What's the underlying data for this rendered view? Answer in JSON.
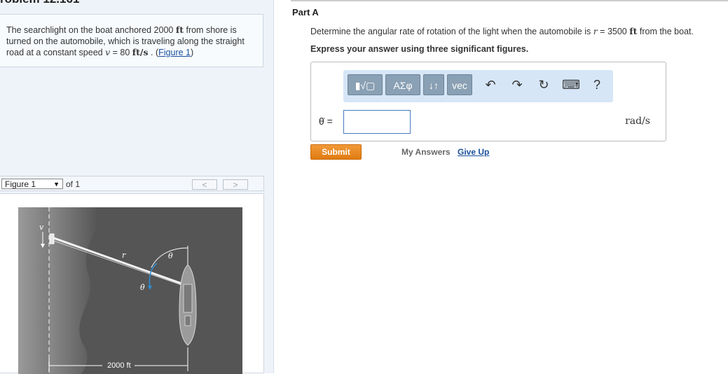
{
  "header": {
    "title_fragment": "roblem 12.161"
  },
  "problem": {
    "text_1": "The searchlight on the boat anchored 2000 ",
    "unit_ft_1": "ft",
    "text_2": " from shore is turned on the automobile, which is traveling along the straight road at a constant speed ",
    "var_v": "v",
    "text_3": " = 80 ",
    "unit_speed": "ft/s",
    "text_4": " . (",
    "figure_link": "Figure 1",
    "text_5": ")"
  },
  "figure_nav": {
    "select_value": "Figure 1",
    "of_label": "of 1",
    "prev_label": "<",
    "next_label": ">"
  },
  "figure": {
    "label_v": "v",
    "label_r": "r",
    "label_theta": "θ",
    "label_theta_dot": "θ̇",
    "label_distance": "2000 ft",
    "colors": {
      "water": "#555555",
      "road": "#8a8a8a",
      "rate_arrow": "#2b8fd8"
    }
  },
  "part": {
    "label": "Part A",
    "question_1": "Determine the angular rate of rotation of the light when the automobile is ",
    "question_var": "r",
    "question_2": " = 3500 ",
    "question_unit": "ft",
    "question_3": " from the boat.",
    "instruction": "Express your answer using three significant figures."
  },
  "toolbar": {
    "template_btn": "▮√▢",
    "greek_btn": "ΑΣφ",
    "arrows_btn": "↓↑",
    "vec_btn": "vec",
    "undo_icon": "↶",
    "redo_icon": "↷",
    "reset_icon": "↻",
    "keyboard_icon": "⌨",
    "help_icon": "?"
  },
  "answer": {
    "variable": "θ̇ =",
    "value": "",
    "unit": "rad/s"
  },
  "actions": {
    "submit": "Submit",
    "my_answers": "My Answers",
    "give_up": "Give Up"
  }
}
